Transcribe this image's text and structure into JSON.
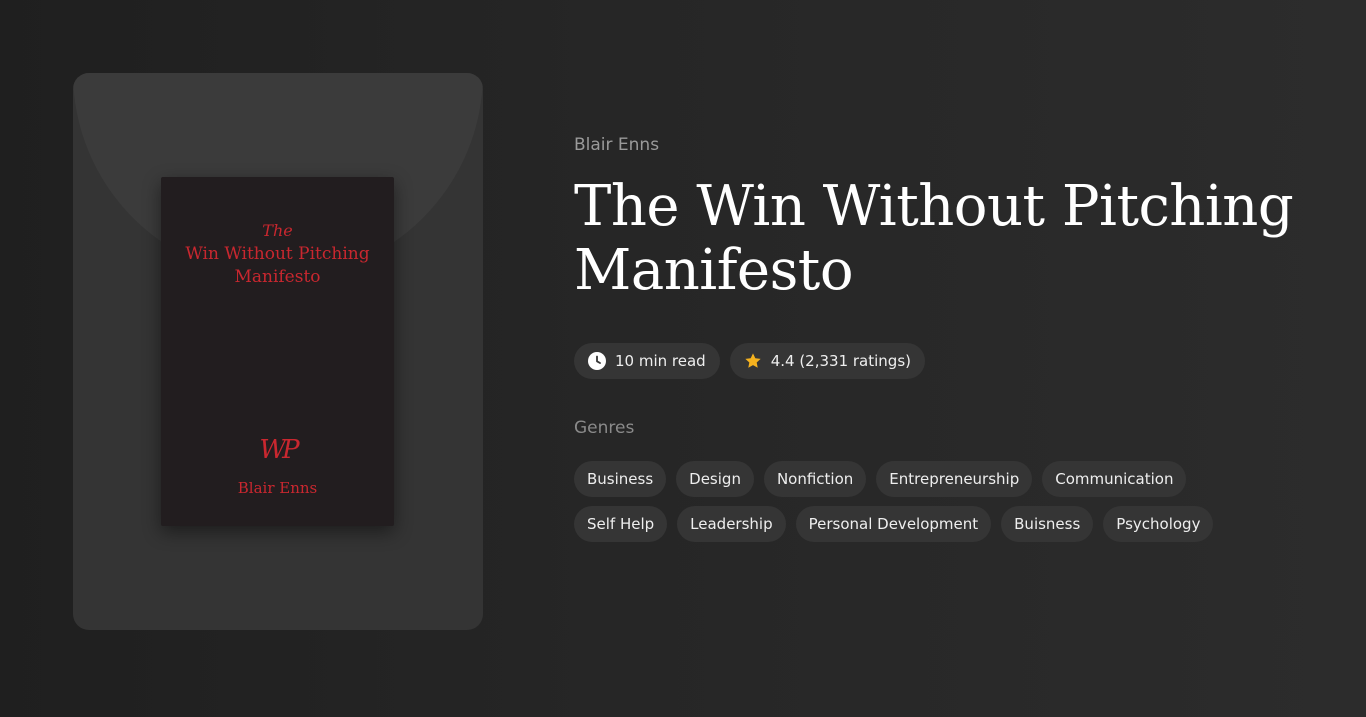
{
  "book": {
    "author": "Blair Enns",
    "title": "The Win Without Pitching Manifesto",
    "cover": {
      "the": "The",
      "title_line1": "Win Without Pitching",
      "title_line2": "Manifesto",
      "monogram": "WP",
      "author": "Blair Enns",
      "text_color": "#c9272f",
      "background_color": "#221d1f"
    }
  },
  "stats": {
    "read_time": "10 min read",
    "read_time_icon": "clock-icon",
    "rating": "4.4 (2,331 ratings)",
    "rating_icon": "star-icon",
    "star_color": "#f5b21f"
  },
  "genres": {
    "label": "Genres",
    "items": [
      "Business",
      "Design",
      "Nonfiction",
      "Entrepreneurship",
      "Communication",
      "Self Help",
      "Leadership",
      "Personal Development",
      "Buisness",
      "Psychology"
    ]
  }
}
